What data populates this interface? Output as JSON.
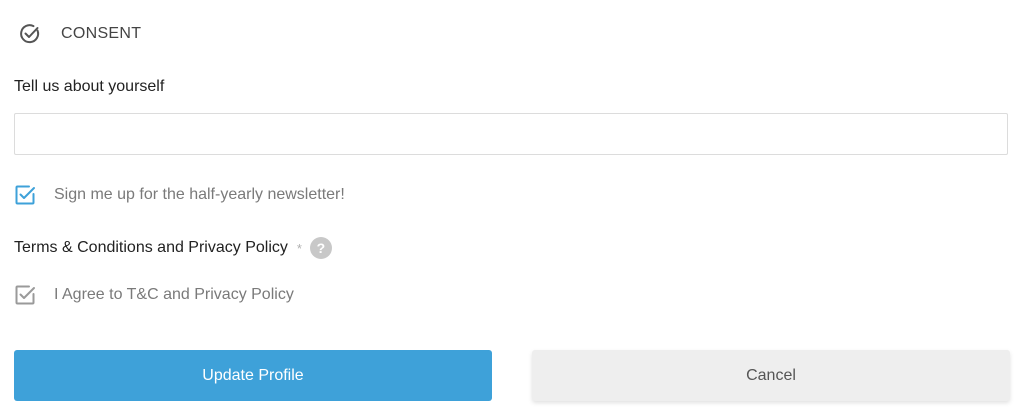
{
  "consent": {
    "title": "CONSENT",
    "icon": "check-circle-icon"
  },
  "about": {
    "label": "Tell us about yourself",
    "value": "",
    "placeholder": ""
  },
  "newsletter": {
    "label": "Sign me up for the half-yearly newsletter!",
    "checked": true,
    "icon": "checkbox-checked-icon",
    "color": "#3ea1d9"
  },
  "terms": {
    "label": "Terms & Conditions and Privacy Policy",
    "required_marker": "*",
    "help_glyph": "?",
    "help_icon": "help-circle-icon"
  },
  "agree": {
    "label": "I Agree to T&C and Privacy Policy",
    "checked": true,
    "icon": "checkbox-checked-icon",
    "color": "#9a9a9a"
  },
  "buttons": {
    "update_label": "Update Profile",
    "cancel_label": "Cancel",
    "update_color": "#3ea1d9",
    "cancel_color": "#eeeeee"
  }
}
